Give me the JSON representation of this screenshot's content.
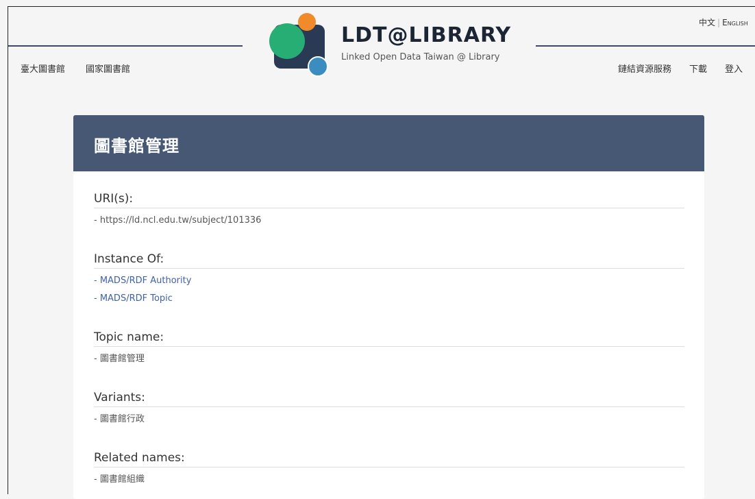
{
  "lang": {
    "zh": "中文",
    "en": "English"
  },
  "brand": {
    "title": "LDT@LIBRARY",
    "subtitle": "Linked Open Data Taiwan @ Library",
    "colors": {
      "navy": "#2a3a55",
      "green": "#27ae74",
      "orange": "#f08a2b",
      "blue": "#3b8cc0"
    }
  },
  "nav_left": [
    "臺大圖書館",
    "國家圖書館"
  ],
  "nav_right": [
    "鏈結資源服務",
    "下載",
    "登入"
  ],
  "card": {
    "title": "圖書館管理",
    "sections": [
      {
        "label": "URI(s):",
        "values": [
          {
            "text": "- https://ld.ncl.edu.tw/subject/101336",
            "link": false
          }
        ]
      },
      {
        "label": "Instance Of:",
        "values": [
          {
            "text": "- MADS/RDF Authority",
            "link": true
          },
          {
            "text": "- MADS/RDF Topic",
            "link": true
          }
        ]
      },
      {
        "label": "Topic name:",
        "values": [
          {
            "text": "- 圖書館管理",
            "link": false
          }
        ]
      },
      {
        "label": "Variants:",
        "values": [
          {
            "text": "- 圖書館行政",
            "link": false
          }
        ]
      },
      {
        "label": "Related names:",
        "values": [
          {
            "text": "- 圖書館組織",
            "link": false
          }
        ]
      }
    ]
  },
  "colors": {
    "header_bar": "#475875",
    "link": "#3f62a8",
    "page_bg": "#f5f5f5"
  }
}
